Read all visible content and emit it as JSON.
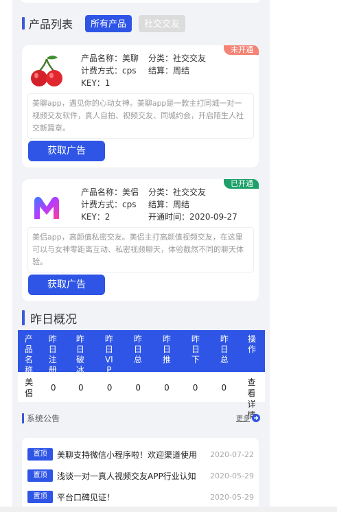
{
  "products_section": {
    "title": "产品列表",
    "filters": [
      {
        "label": "所有产品",
        "active": true
      },
      {
        "label": "社交交友",
        "active": false
      }
    ]
  },
  "products": [
    {
      "status": "未开通",
      "status_color": "#f48576",
      "icon": "cherry-icon",
      "name_label": "产品名称：美聊",
      "category_label": "分类：社交交友",
      "billing_label": "计费方式：cps",
      "settle_label": "结算：周结",
      "key_label": "KEY：1",
      "open_time_label": "",
      "description": "美聊app，遇见你的心动女神。美聊app是一款主打同城一对一视频交友软件，真人自拍、视频交友、同城约会，开启陌生人社交新篇章。",
      "button": "获取广告"
    },
    {
      "status": "已开通",
      "status_color": "#1ea06a",
      "icon": "m-logo-icon",
      "name_label": "产品名称：美侣",
      "category_label": "分类：社交交友",
      "billing_label": "计费方式：cps",
      "settle_label": "结算：周结",
      "key_label": "KEY：2",
      "open_time_label": "开通时间：2020-09-27",
      "description": "美侣app，高颜值私密交友。美侣主打高颜值视频交友，在这里可以与女神零距离互动、私密视频聊天，体验截然不同的聊天体验。",
      "button": "获取广告"
    }
  ],
  "yesterday": {
    "title": "昨日概况",
    "headers": [
      "产品名称",
      "昨日注册",
      "昨日破冰",
      "昨日VIP",
      "昨日总",
      "昨日推",
      "昨日下",
      "昨日总",
      "操作"
    ],
    "row": [
      "美侣",
      "0",
      "0",
      "0",
      "0",
      "0",
      "0",
      "0",
      "查看详情"
    ]
  },
  "notice_section": {
    "title": "系统公告",
    "more": "更多"
  },
  "notices": [
    {
      "tag": "置顶",
      "title": "美聊支持微信小程序啦！欢迎渠道使用",
      "date": "2020-07-22"
    },
    {
      "tag": "置顶",
      "title": "浅谈一对一真人视频交友APP行业认知",
      "date": "2020-05-29"
    },
    {
      "tag": "置顶",
      "title": "平台口碑见证！",
      "date": "2020-05-29"
    }
  ],
  "colors": {
    "accent": "#2f55e6",
    "page_bg": "#f2f3f7"
  }
}
